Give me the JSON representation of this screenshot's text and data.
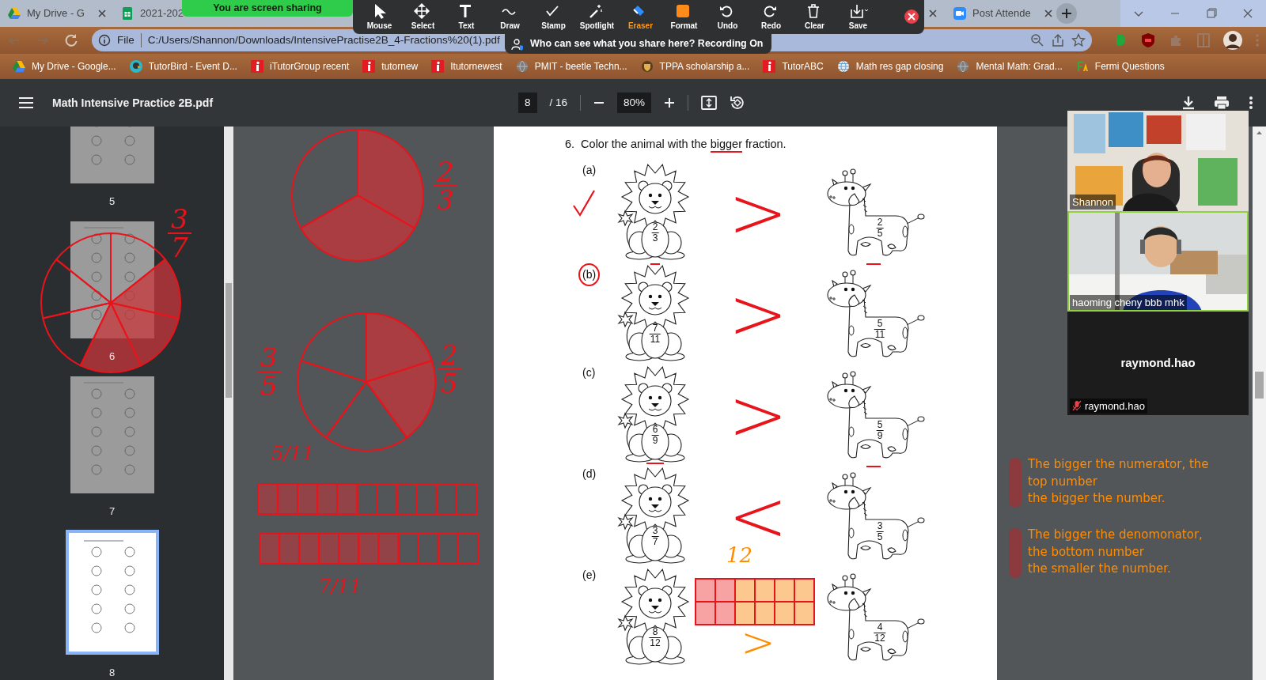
{
  "browser": {
    "tabs": [
      {
        "title": "My Drive - G",
        "kind": "drive",
        "selected": false
      },
      {
        "title": "2021-202",
        "kind": "sheets",
        "selected": false
      },
      {
        "title": "Post Attende",
        "kind": "zoom",
        "selected": false
      }
    ],
    "address_prefix": "File",
    "address": "C:/Users/Shannon/Downloads/IntensivePractise2B_4-Fractions%20(1).pdf",
    "bookmarks": [
      {
        "title": "My Drive - Google...",
        "kind": "drive"
      },
      {
        "title": "TutorBird - Event D...",
        "kind": "bird"
      },
      {
        "title": "iTutorGroup recent",
        "kind": "itutor"
      },
      {
        "title": "tutornew",
        "kind": "itutor"
      },
      {
        "title": "Itutornewest",
        "kind": "itutor"
      },
      {
        "title": "PMIT - beetle Techn...",
        "kind": "globe"
      },
      {
        "title": "TPPA scholarship a...",
        "kind": "crest"
      },
      {
        "title": "TutorABC",
        "kind": "itutor"
      },
      {
        "title": "Math res gap closing",
        "kind": "earth"
      },
      {
        "title": "Mental Math: Grad...",
        "kind": "globe"
      },
      {
        "title": "Fermi Questions",
        "kind": "fermi"
      }
    ]
  },
  "share": {
    "banner": "You are screen sharing",
    "notice": "Who can see what you share here? Recording On",
    "tools": [
      {
        "label": "Mouse",
        "selected": false
      },
      {
        "label": "Select",
        "selected": false
      },
      {
        "label": "Text",
        "selected": false
      },
      {
        "label": "Draw",
        "selected": false
      },
      {
        "label": "Stamp",
        "selected": false
      },
      {
        "label": "Spotlight",
        "selected": false
      },
      {
        "label": "Eraser",
        "selected": true
      },
      {
        "label": "Format",
        "selected": false
      },
      {
        "label": "Undo",
        "selected": false
      },
      {
        "label": "Redo",
        "selected": false
      },
      {
        "label": "Clear",
        "selected": false
      },
      {
        "label": "Save",
        "selected": false
      }
    ]
  },
  "pdf_toolbar": {
    "title": "Math Intensive Practice 2B.pdf",
    "page": "8",
    "page_count": "/ 16",
    "zoom": "80%"
  },
  "thumbnails": [
    {
      "page": "5",
      "selected": false
    },
    {
      "page": "6",
      "selected": false
    },
    {
      "page": "7",
      "selected": false
    },
    {
      "page": "8",
      "selected": true
    }
  ],
  "sidebar_ink": {
    "pie": {
      "sectors": [
        {
          "shaded": false
        },
        {
          "shaded": true
        },
        {
          "shaded": true
        },
        {
          "shaded": true
        },
        {
          "shaded": false
        },
        {
          "shaded": false
        },
        {
          "shaded": false
        }
      ]
    },
    "handwriting": {
      "kind": "stacked",
      "numerator": "3",
      "denominator": "7"
    }
  },
  "worksheet": {
    "number": "6.",
    "prompt_before": "Color the animal with the ",
    "prompt_underlined": "bigger",
    "prompt_after": " fraction.",
    "items": [
      {
        "label": "(a)",
        "lion": {
          "numerator": "2",
          "denominator": "3"
        },
        "giraffe": {
          "numerator": "2",
          "denominator": "5"
        },
        "sign": ">",
        "color": "#e8141b",
        "checked": true,
        "circled": false,
        "dash_below_lion": true,
        "dash_below_giraffe": true
      },
      {
        "label": "(b)",
        "lion": {
          "numerator": "7",
          "denominator": "11"
        },
        "giraffe": {
          "numerator": "5",
          "denominator": "11"
        },
        "sign": ">",
        "color": "#e8141b",
        "checked": false,
        "circled": true
      },
      {
        "label": "(c)",
        "lion": {
          "numerator": "6",
          "denominator": "9"
        },
        "giraffe": {
          "numerator": "5",
          "denominator": "9"
        },
        "sign": ">",
        "color": "#e8141b",
        "checked": false,
        "circled": false,
        "dash_below_giraffe": true
      },
      {
        "label": "(d)",
        "lion": {
          "numerator": "3",
          "denominator": "7"
        },
        "giraffe": {
          "numerator": "3",
          "denominator": "5"
        },
        "sign": "<",
        "color": "#e8141b",
        "checked": false,
        "circled": false,
        "dash_above_lion": true
      },
      {
        "label": "(e)",
        "lion": {
          "numerator": "8",
          "denominator": "12"
        },
        "giraffe": {
          "numerator": "4",
          "denominator": "12"
        },
        "sign": ">",
        "color": "#ff8c00",
        "checked": false,
        "circled": false,
        "bar_model": {
          "note": "12",
          "rows": [
            [
              {
                "color": "#f7a3a3"
              },
              {
                "color": "#f7a3a3"
              },
              {
                "color": "#fcc88f"
              },
              {
                "color": "#fcc88f"
              },
              {
                "color": "#fcc88f"
              },
              {
                "color": "#fcc88f"
              }
            ],
            [
              {
                "color": "#f7a3a3"
              },
              {
                "color": "#f7a3a3"
              },
              {
                "color": "#fcc88f"
              },
              {
                "color": "#fcc88f"
              },
              {
                "color": "#fcc88f"
              },
              {
                "color": "#fcc88f"
              }
            ]
          ]
        }
      }
    ]
  },
  "ink": {
    "pies": [
      {
        "sectors": [
          {
            "shaded": true
          },
          {
            "shaded": true
          },
          {
            "shaded": false
          }
        ]
      },
      {
        "sectors": [
          {
            "shaded": true
          },
          {
            "shaded": true
          },
          {
            "shaded": false
          },
          {
            "shaded": false
          },
          {
            "shaded": false
          }
        ]
      }
    ],
    "bars": [
      {
        "cells": [
          {
            "shaded": true
          },
          {
            "shaded": true
          },
          {
            "shaded": true
          },
          {
            "shaded": true
          },
          {
            "shaded": true
          },
          {
            "shaded": false
          },
          {
            "shaded": false
          },
          {
            "shaded": false
          },
          {
            "shaded": false
          },
          {
            "shaded": false
          },
          {
            "shaded": false
          }
        ]
      },
      {
        "cells": [
          {
            "shaded": true
          },
          {
            "shaded": true
          },
          {
            "shaded": true
          },
          {
            "shaded": true
          },
          {
            "shaded": true
          },
          {
            "shaded": true
          },
          {
            "shaded": true
          },
          {
            "shaded": false
          },
          {
            "shaded": false
          },
          {
            "shaded": false
          },
          {
            "shaded": false
          }
        ]
      }
    ],
    "handwriting": [
      {
        "kind": "stacked",
        "numerator": "2",
        "denominator": "3"
      },
      {
        "kind": "stacked",
        "numerator": "3",
        "denominator": "5"
      },
      {
        "kind": "stacked",
        "numerator": "2",
        "denominator": "5"
      },
      {
        "kind": "inline",
        "text": "5/11"
      },
      {
        "kind": "inline",
        "text": "7/11"
      }
    ]
  },
  "notes": [
    {
      "lines": [
        "The bigger the numerator, the",
        "top number",
        "the bigger the number."
      ]
    },
    {
      "lines": [
        "The bigger the denomonator,",
        "the bottom number",
        "the smaller the number."
      ]
    }
  ],
  "participants": [
    {
      "name": "Shannon",
      "kind": "video",
      "active": false
    },
    {
      "name": "haoming cheny bbb mhk",
      "kind": "video",
      "active": true
    },
    {
      "title": "raymond.hao",
      "name": "raymond.hao",
      "kind": "avatar",
      "muted": true
    }
  ]
}
